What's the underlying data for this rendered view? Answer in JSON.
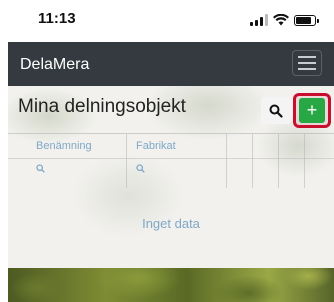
{
  "status_bar": {
    "time": "11:13"
  },
  "navbar": {
    "brand": "DelaMera",
    "menu_icon": "hamburger-icon"
  },
  "page": {
    "title": "Mina delningsobjekt",
    "search_icon": "search-icon",
    "add_label": "+"
  },
  "table": {
    "columns": [
      {
        "header": "Benämning"
      },
      {
        "header": "Fabrikat"
      }
    ],
    "empty_text": "Inget data"
  },
  "colors": {
    "navbar_bg": "#343a40",
    "add_button": "#28a745",
    "highlight": "#c8102e",
    "muted_blue": "#7fa8c7"
  }
}
